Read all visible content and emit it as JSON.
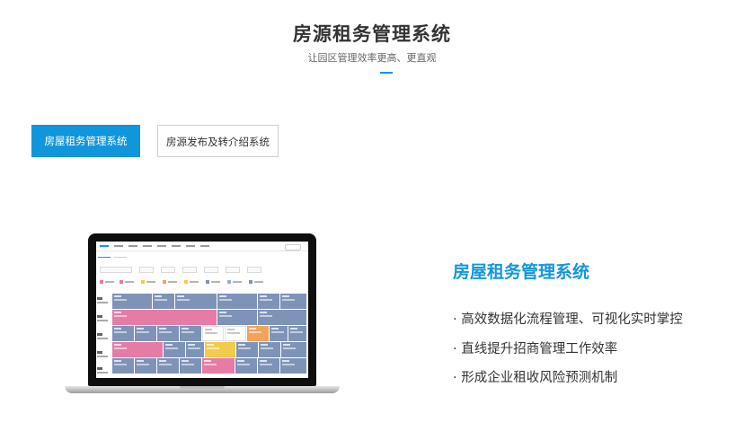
{
  "header": {
    "title": "房源租务管理系统",
    "subtitle": "让园区管理效率更高、更直观"
  },
  "tabs": [
    {
      "label": "房屋租务管理系统",
      "active": true
    },
    {
      "label": "房源发布及转介绍系统",
      "active": false
    }
  ],
  "feature": {
    "title": "房屋租务管理系统",
    "items": [
      "· 高效数据化流程管理、可视化实时掌控",
      "· 直线提升招商管理工作效率",
      "· 形成企业租收风险预测机制"
    ]
  },
  "colors": {
    "accent": "#1296db",
    "screen_cell_blue": "#7d93b8",
    "screen_cell_pink": "#e67ba6",
    "screen_cell_yellow": "#f2cb4c",
    "screen_cell_orange": "#f1a35c"
  },
  "icons": {
    "device": "laptop-icon"
  }
}
